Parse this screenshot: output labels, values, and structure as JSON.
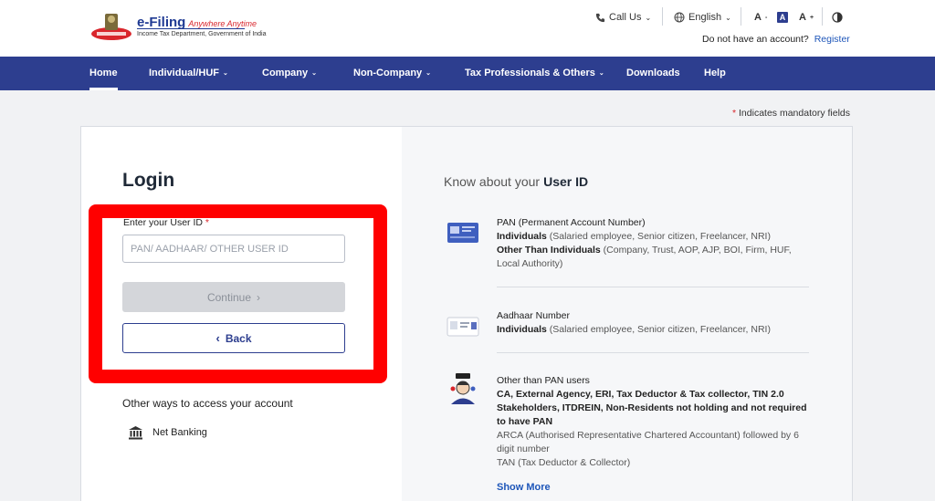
{
  "header": {
    "brand_name": "e-Filing",
    "brand_tagline": "Anywhere Anytime",
    "department": "Income Tax Department, Government of India",
    "call_us": "Call Us",
    "language": "English",
    "no_account_text": "Do not have an account?",
    "register_link": "Register"
  },
  "nav": {
    "items": [
      {
        "label": "Home",
        "active": true
      },
      {
        "label": "Individual/HUF"
      },
      {
        "label": "Company"
      },
      {
        "label": "Non-Company"
      },
      {
        "label": "Tax Professionals & Others"
      },
      {
        "label": "Downloads"
      },
      {
        "label": "Help"
      }
    ]
  },
  "mandatory_note": "Indicates mandatory fields",
  "login": {
    "title": "Login",
    "user_id_label": "Enter your User ID",
    "user_id_placeholder": "PAN/ AADHAAR/ OTHER USER ID",
    "continue_label": "Continue",
    "back_label": "Back",
    "other_ways": "Other ways to access your account",
    "net_banking": "Net Banking"
  },
  "know": {
    "title_prefix": "Know about your",
    "title_bold": "User ID",
    "pan": {
      "heading": "PAN (Permanent Account Number)",
      "line1_bold": "Individuals",
      "line1_rest": " (Salaried employee, Senior citizen, Freelancer, NRI)",
      "line2_bold": "Other Than Individuals",
      "line2_rest": " (Company, Trust, AOP, AJP, BOI, Firm, HUF, Local Authority)"
    },
    "aadhaar": {
      "heading": "Aadhaar Number",
      "line1_bold": "Individuals",
      "line1_rest": " (Salaried employee, Senior citizen, Freelancer, NRI)"
    },
    "other": {
      "heading": "Other than PAN users",
      "bold_text": "CA, External Agency, ERI, Tax Deductor & Tax collector, TIN 2.0 Stakeholders, ITDREIN, Non-Residents not holding and not required to have PAN",
      "arca": "ARCA (Authorised Representative Chartered Accountant) followed by 6 digit number",
      "tan": "TAN (Tax Deductor & Collector)"
    },
    "show_more": "Show More"
  }
}
